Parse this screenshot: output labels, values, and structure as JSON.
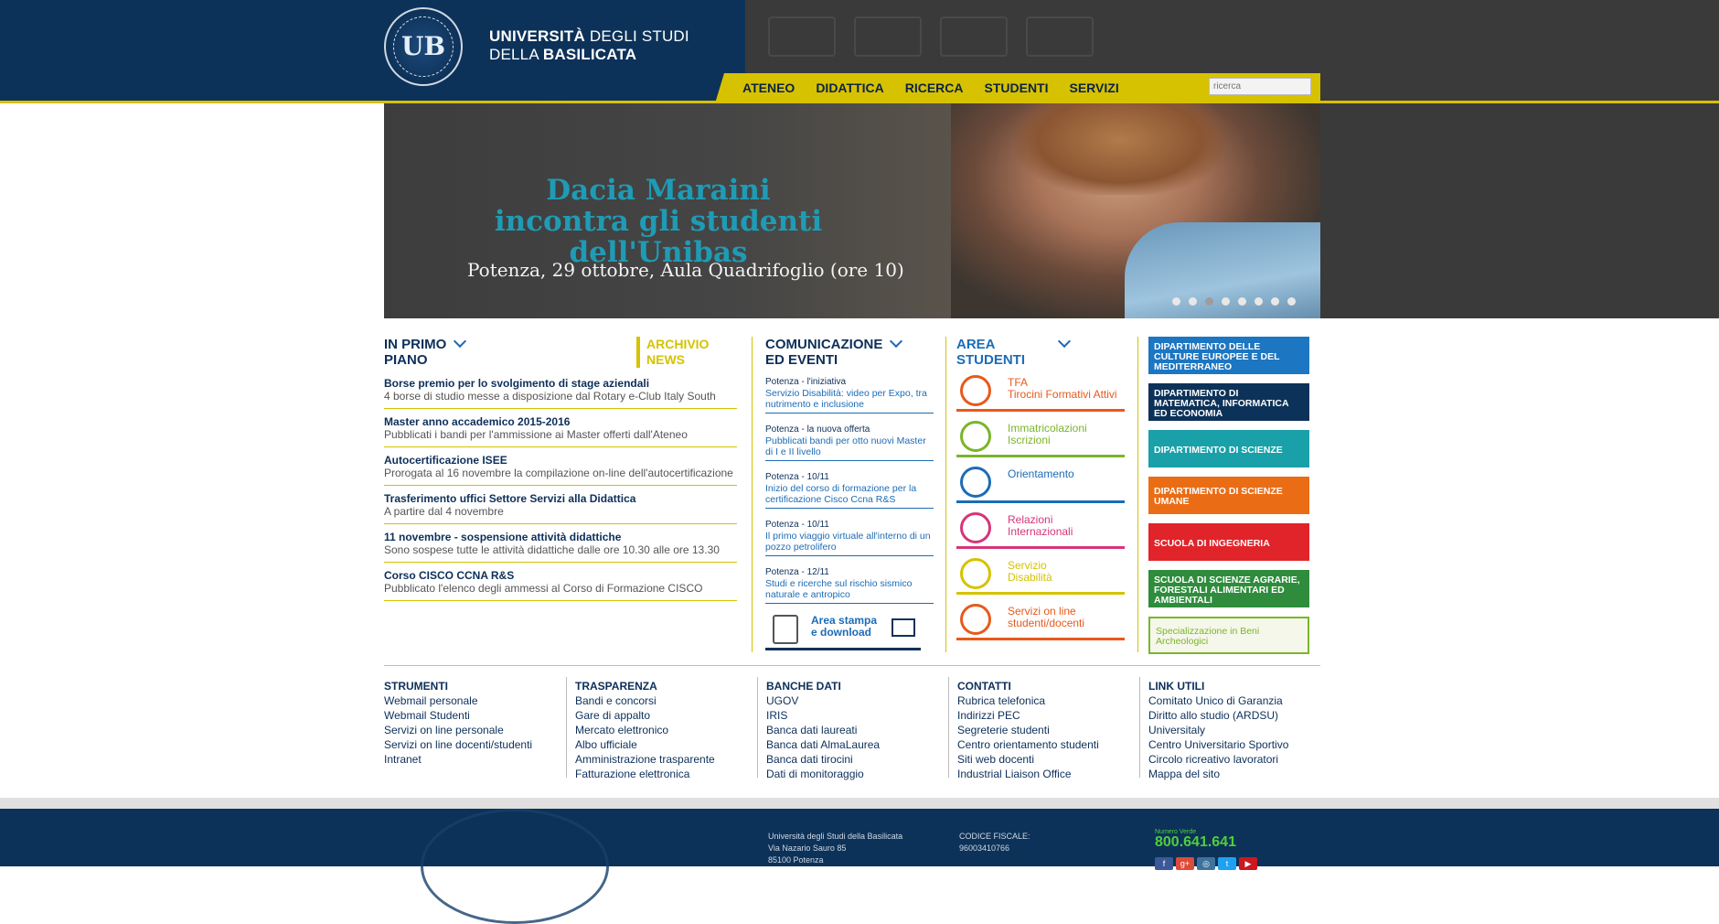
{
  "brand": {
    "line1_bold": "UNIVERSITÀ",
    "line1_light": " DEGLI STUDI",
    "line2_light": "DELLA ",
    "line2_bold": "BASILICATA",
    "seal_mono": "UB"
  },
  "nav": [
    "ATENEO",
    "DIDATTICA",
    "RICERCA",
    "STUDENTI",
    "SERVIZI"
  ],
  "search": {
    "placeholder": "ricerca"
  },
  "hero": {
    "title1": "Dacia Maraini",
    "title2": "incontra gli studenti dell'Unibas",
    "subtitle": "Potenza,  29 ottobre, Aula Quadrifoglio (ore 10)",
    "dots": 8,
    "active_dot": 3
  },
  "primo_piano": {
    "title1": "IN PRIMO",
    "title2": "PIANO",
    "archivio1": "ARCHIVIO",
    "archivio2": "NEWS",
    "items": [
      {
        "title": "Borse premio per lo svolgimento di stage aziendali",
        "desc": "4 borse di studio messe a disposizione dal Rotary e-Club Italy South"
      },
      {
        "title": "Master anno accademico 2015-2016",
        "desc": "Pubblicati i bandi per l'ammissione ai Master offerti dall'Ateneo"
      },
      {
        "title": "Autocertificazione ISEE",
        "desc": "Prorogata al 16 novembre la compilazione on-line dell'autocertificazione"
      },
      {
        "title": "Trasferimento uffici Settore Servizi alla Didattica",
        "desc": "A partire dal 4 novembre"
      },
      {
        "title": "11 novembre - sospensione attività didattiche",
        "desc": "Sono sospese tutte le attività didattiche dalle ore 10.30 alle ore 13.30"
      },
      {
        "title": "Corso CISCO CCNA R&S",
        "desc": "Pubblicato l'elenco degli ammessi al Corso di Formazione CISCO"
      }
    ]
  },
  "comunicazione": {
    "title1": "COMUNICAZIONE",
    "title2": "ED EVENTI",
    "items": [
      {
        "head": "Potenza - l'iniziativa",
        "link": "Servizio Disabilità: video per Expo, tra nutrimento e inclusione"
      },
      {
        "head": "Potenza - la nuova offerta",
        "link": "Pubblicati bandi per otto nuovi Master di I e II livello"
      },
      {
        "head": "Potenza - 10/11",
        "link": "Inizio del corso di formazione per la certificazione Cisco Ccna R&S"
      },
      {
        "head": "Potenza - 10/11",
        "link": "Il primo viaggio virtuale all'interno di un pozzo petrolifero"
      },
      {
        "head": "Potenza - 12/11",
        "link": "Studi e ricerche sul rischio sismico naturale e antropico"
      }
    ],
    "area_stampa1": "Area stampa",
    "area_stampa2": "e download"
  },
  "area_studenti": {
    "title1": "AREA",
    "title2": "STUDENTI",
    "items": [
      {
        "l1": "TFA",
        "l2": "Tirocini Formativi Attivi",
        "color": "#e8591a",
        "icon": "document-icon"
      },
      {
        "l1": "Immatricolazioni",
        "l2": "Iscrizioni",
        "color": "#7ab52b",
        "icon": "students-icon"
      },
      {
        "l1": "Orientamento",
        "l2": "",
        "color": "#1c6cb7",
        "icon": "orientation-ring-icon"
      },
      {
        "l1": "Relazioni",
        "l2": "Internazionali",
        "color": "#d6357a",
        "icon": "globe-icon"
      },
      {
        "l1": "Servizio",
        "l2": "Disabilità",
        "color": "#d6c200",
        "icon": "handshake-icon"
      },
      {
        "l1": "Servizi on line",
        "l2": "studenti/docenti",
        "color": "#e8591a",
        "icon": "briefcase-icon"
      }
    ]
  },
  "departments": [
    {
      "label": "DIPARTIMENTO DELLE CULTURE EUROPEE E DEL MEDITERRANEO",
      "color": "#1c76c2"
    },
    {
      "label": "DIPARTIMENTO DI MATEMATICA, INFORMATICA ED ECONOMIA",
      "color": "#0d3259"
    },
    {
      "label": "DIPARTIMENTO DI SCIENZE",
      "color": "#1aa0a8"
    },
    {
      "label": "DIPARTIMENTO DI SCIENZE UMANE",
      "color": "#ea6d16"
    },
    {
      "label": "SCUOLA DI INGEGNERIA",
      "color": "#e0242a"
    },
    {
      "label": "SCUOLA DI SCIENZE AGRARIE, FORESTALI ALIMENTARI ED AMBIENTALI",
      "color": "#2e8c3c"
    },
    {
      "label": "Specializzazione in Beni Archeologici",
      "color": "#7ab52b"
    }
  ],
  "links": [
    {
      "head": "STRUMENTI",
      "items": [
        "Webmail personale",
        "Webmail Studenti",
        "Servizi on line personale",
        "Servizi on line docenti/studenti",
        "Intranet"
      ]
    },
    {
      "head": "TRASPARENZA",
      "items": [
        "Bandi e concorsi",
        "Gare di appalto",
        "Mercato elettronico",
        "Albo ufficiale",
        "Amministrazione trasparente",
        "Fatturazione elettronica"
      ]
    },
    {
      "head": "BANCHE DATI",
      "items": [
        "UGOV",
        "IRIS",
        "Banca dati laureati",
        "Banca dati AlmaLaurea",
        "Banca dati tirocini",
        "Dati di monitoraggio"
      ]
    },
    {
      "head": "CONTATTI",
      "items": [
        "Rubrica telefonica",
        "Indirizzi PEC",
        "Segreterie studenti",
        "Centro orientamento studenti",
        "Siti web docenti",
        "Industrial Liaison Office"
      ]
    },
    {
      "head": "LINK UTILI",
      "items": [
        "Comitato Unico di Garanzia",
        "Diritto allo studio (ARDSU)",
        "Universitaly",
        "Centro Universitario Sportivo",
        "Circolo ricreativo lavoratori",
        "Mappa del sito"
      ]
    }
  ],
  "footer": {
    "addr1": "Università degli Studi della Basilicata",
    "addr2": "Via Nazario Sauro 85",
    "addr3": "85100 Potenza",
    "cf_label": "CODICE FISCALE:",
    "cf_value": "96003410766",
    "numero_verde_label": "Numero Verde",
    "numero_verde": "800.641.641",
    "social": [
      {
        "icon": "facebook-icon",
        "glyph": "f",
        "color": "#3b5998"
      },
      {
        "icon": "google-plus-icon",
        "glyph": "g+",
        "color": "#dd4b39"
      },
      {
        "icon": "instagram-icon",
        "glyph": "◎",
        "color": "#3f729b"
      },
      {
        "icon": "twitter-icon",
        "glyph": "t",
        "color": "#1da1f2"
      },
      {
        "icon": "youtube-icon",
        "glyph": "▶",
        "color": "#cc181e"
      }
    ]
  }
}
